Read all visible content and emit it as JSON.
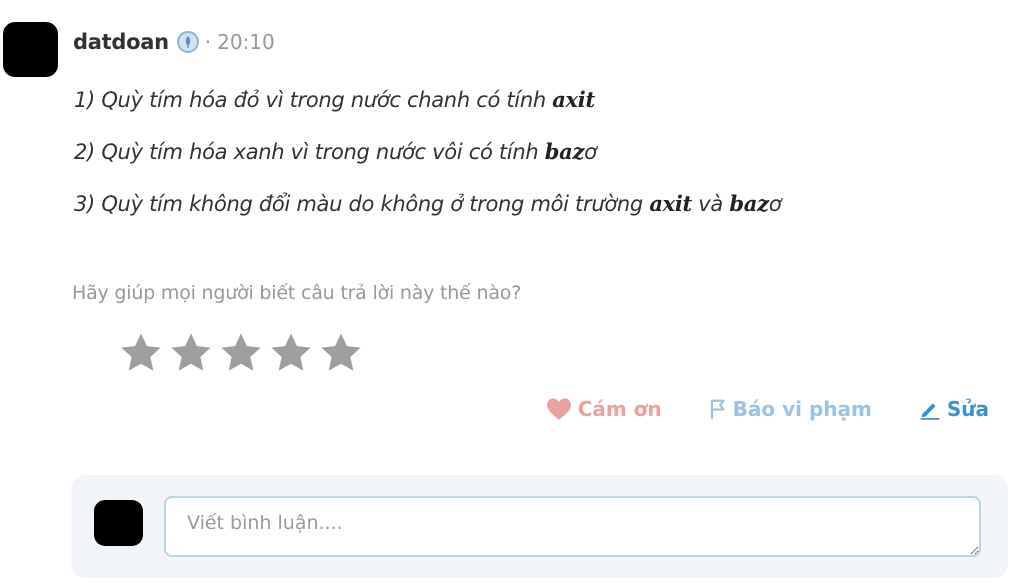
{
  "post": {
    "username": "datdoan",
    "badge_icon": "leaf-badge-icon",
    "separator": "·",
    "time": "20:10"
  },
  "answer": {
    "lines": [
      {
        "text": "1) Quỳ tím hóa đỏ vì trong nước chanh có tính ",
        "math1": "axit",
        "mid": "",
        "math2": "",
        "tail": ""
      },
      {
        "text": "2) Quỳ tím hóa xanh vì trong nước vôi có tính ",
        "math1": "baz",
        "mid": "ơ",
        "math2": "",
        "tail": ""
      },
      {
        "text": "3) Quỳ tím không đổi màu do không ở trong môi trường ",
        "math1": "axit",
        "mid": " và ",
        "math2": "baz",
        "tail": "ơ"
      }
    ]
  },
  "rating": {
    "prompt": "Hãy giúp mọi người biết câu trả lời này thế nào?",
    "value": 0,
    "max": 5,
    "star_color": "#9e9e9e"
  },
  "actions": {
    "thanks_label": "Cám ơn",
    "report_label": "Báo vi phạm",
    "edit_label": "Sửa",
    "colors": {
      "thanks": "#eaa1a1",
      "report": "#9cc3e6",
      "edit": "#3b8ed8"
    }
  },
  "comment": {
    "placeholder": "Viết bình luận...."
  }
}
